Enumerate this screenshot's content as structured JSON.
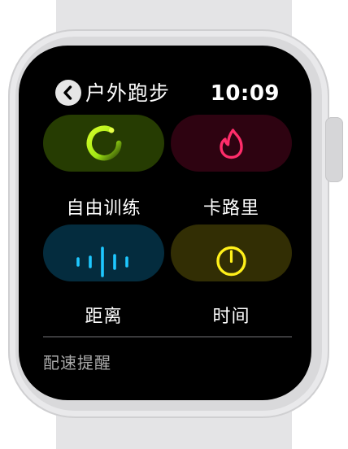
{
  "header": {
    "title": "户外跑步",
    "time": "10:09"
  },
  "tiles": [
    {
      "label": "自由训练",
      "icon": "open-goal-ring-icon",
      "color": "#b7f21a"
    },
    {
      "label": "卡路里",
      "icon": "flame-icon",
      "color": "#ff2d6a"
    },
    {
      "label": "距离",
      "icon": "distance-bars-icon",
      "color": "#1ec8ff"
    },
    {
      "label": "时间",
      "icon": "stopwatch-icon",
      "color": "#fff01a"
    }
  ],
  "footer": {
    "pace_alert_label": "配速提醒"
  }
}
